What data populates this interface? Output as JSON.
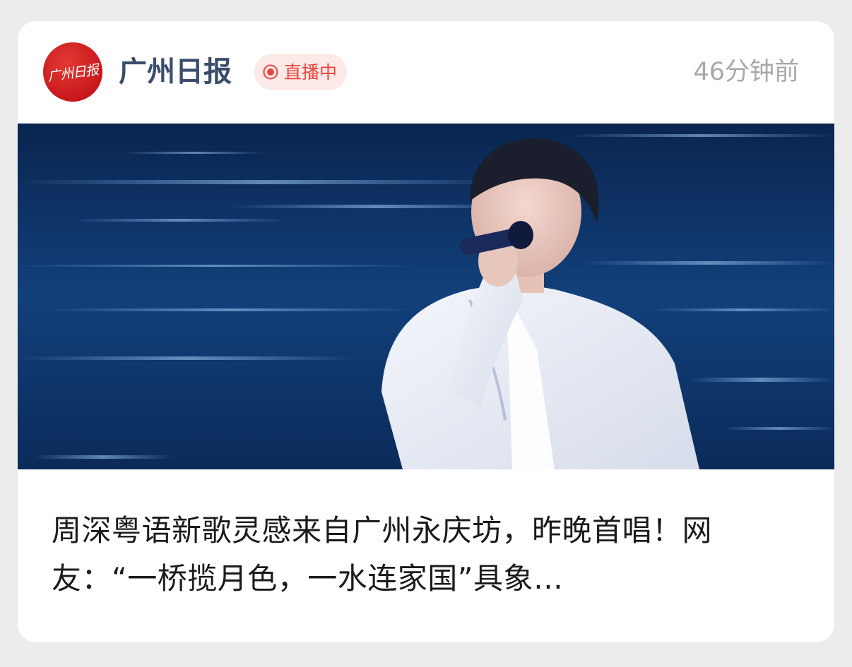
{
  "feed_card": {
    "source": {
      "logo_text": "广州日报",
      "name": "广州日报"
    },
    "live_badge": {
      "icon": "live-dot-icon",
      "label": "直播中",
      "color": "#e8453c"
    },
    "timestamp": "46分钟前",
    "headline": "周深粤语新歌灵感来自广州永庆坊，昨晚首唱！网友：“一桥揽月色，一水连家国”具象…"
  }
}
